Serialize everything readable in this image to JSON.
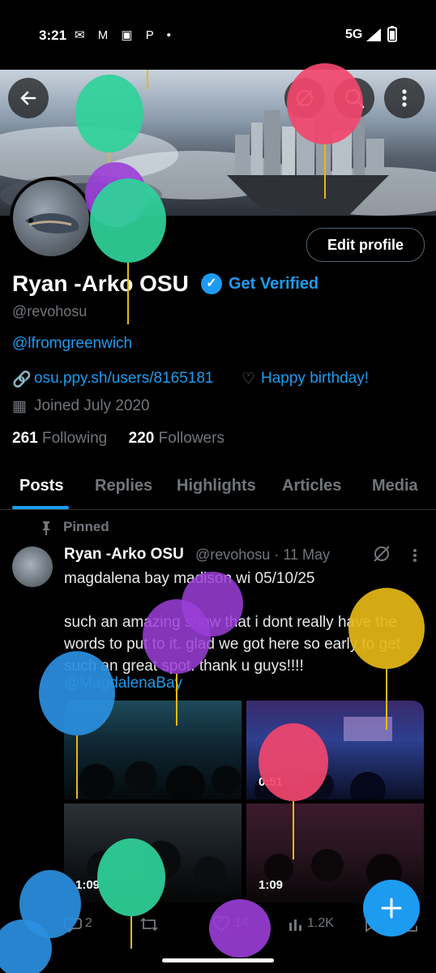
{
  "status_bar": {
    "time": "3:21",
    "left_icons": "✉ M ▣ P •",
    "network": "5G"
  },
  "header": {
    "back_icon": "back-arrow-icon",
    "grok_icon": "grok-icon",
    "search_icon": "search-icon",
    "more_icon": "more-vertical-icon"
  },
  "profile": {
    "display_name": "Ryan -Arko OSU",
    "verified_label": "Get Verified",
    "handle": "@revohosu",
    "bio": "@lfromgreenwich",
    "website": "osu.ppy.sh/users/8165181",
    "birthday": "Happy birthday!",
    "joined": "Joined July 2020",
    "following_count": "261",
    "following_label": "Following",
    "followers_count": "220",
    "followers_label": "Followers",
    "edit_button": "Edit profile"
  },
  "tabs": [
    "Posts",
    "Replies",
    "Highlights",
    "Articles",
    "Media"
  ],
  "post": {
    "pinned_label": "Pinned",
    "author": "Ryan -Arko OSU",
    "handle_date": "@revohosu · 11 May",
    "text": "magdalena bay madison wi 05/10/25\n\nsuch an amazing show that i dont really have the words to put to it. glad we got here so early to get such an great spot. thank u guys!!!!",
    "mention": "@MagdalenaBay",
    "media_durations": [
      "0:51",
      "1:09",
      "1:09"
    ],
    "replies": "2",
    "likes": "14",
    "views": "1.2K"
  },
  "colors": {
    "accent": "#1d9bf0",
    "balloon_green": "#2fd39a",
    "balloon_red": "#f2476e",
    "balloon_purple": "#9b3ed8",
    "balloon_yellow": "#e5b916",
    "balloon_blue": "#2b8fe0"
  }
}
